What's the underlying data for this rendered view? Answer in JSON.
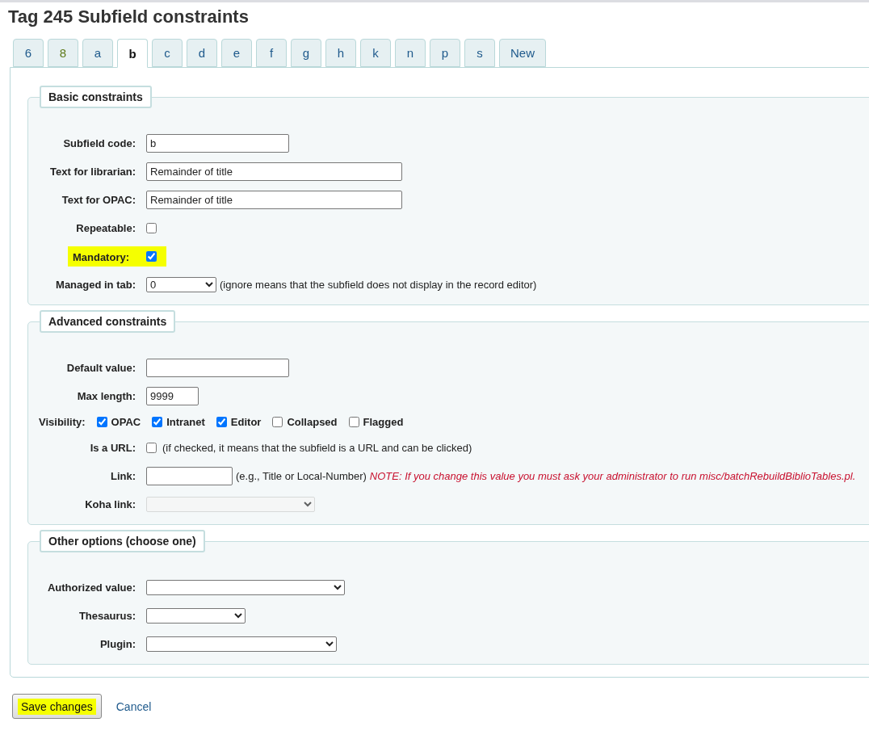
{
  "title": "Tag 245 Subfield constraints",
  "tabs": [
    {
      "label": "6",
      "selected": false,
      "color": "#1f5a8c"
    },
    {
      "label": "8",
      "selected": false,
      "color": "#5e7a1a"
    },
    {
      "label": "a",
      "selected": false,
      "color": "#1f5a8c"
    },
    {
      "label": "b",
      "selected": true,
      "color": "#111111"
    },
    {
      "label": "c",
      "selected": false,
      "color": "#1f5a8c"
    },
    {
      "label": "d",
      "selected": false,
      "color": "#1f5a8c"
    },
    {
      "label": "e",
      "selected": false,
      "color": "#1f5a8c"
    },
    {
      "label": "f",
      "selected": false,
      "color": "#1f5a8c"
    },
    {
      "label": "g",
      "selected": false,
      "color": "#1f5a8c"
    },
    {
      "label": "h",
      "selected": false,
      "color": "#1f5a8c"
    },
    {
      "label": "k",
      "selected": false,
      "color": "#1f5a8c"
    },
    {
      "label": "n",
      "selected": false,
      "color": "#1f5a8c"
    },
    {
      "label": "p",
      "selected": false,
      "color": "#1f5a8c"
    },
    {
      "label": "s",
      "selected": false,
      "color": "#1f5a8c"
    },
    {
      "label": "New",
      "selected": false,
      "color": "#1f5a8c"
    }
  ],
  "sections": [
    {
      "legend": "Basic constraints",
      "fields": [
        {
          "kind": "text",
          "label": "Subfield code:",
          "value": "b",
          "highlighted": false
        },
        {
          "kind": "text",
          "label": "Text for librarian:",
          "value": "Remainder of title",
          "highlighted": false
        },
        {
          "kind": "text",
          "label": "Text for OPAC:",
          "value": "Remainder of title",
          "highlighted": false
        },
        {
          "kind": "checkbox",
          "label": "Repeatable:",
          "checked": false,
          "highlighted": false
        },
        {
          "kind": "checkbox",
          "label": "Mandatory:",
          "checked": true,
          "highlighted": true
        },
        {
          "kind": "select",
          "label": "Managed in tab:",
          "value": "0",
          "hint": "(ignore means that the subfield does not display in the record editor)",
          "disabled": false,
          "highlighted": false
        }
      ]
    },
    {
      "legend": "Advanced constraints",
      "fields": [
        {
          "kind": "text",
          "label": "Default value:",
          "highlighted": false
        },
        {
          "kind": "text",
          "label": "Max length:",
          "value": "9999",
          "highlighted": false
        },
        {
          "kind": "visibility",
          "label": "Visibility:",
          "highlighted": false,
          "options": [
            {
              "label": "OPAC",
              "checked": true
            },
            {
              "label": "Intranet",
              "checked": true
            },
            {
              "label": "Editor",
              "checked": true
            },
            {
              "label": "Collapsed",
              "checked": false
            },
            {
              "label": "Flagged",
              "checked": false
            }
          ]
        },
        {
          "kind": "checkbox",
          "label": "Is a URL:",
          "checked": false,
          "hint": "(if checked, it means that the subfield is a URL and can be clicked)",
          "highlighted": false
        },
        {
          "kind": "text",
          "label": "Link:",
          "hint": "(e.g., Title or Local-Number)",
          "note": "NOTE: If you change this value you must ask your administrator to run misc/batchRebuildBiblioTables.pl.",
          "highlighted": false
        },
        {
          "kind": "select",
          "label": "Koha link:",
          "disabled": true,
          "highlighted": false
        }
      ]
    },
    {
      "legend": "Other options (choose one)",
      "fields": [
        {
          "kind": "select",
          "label": "Authorized value:",
          "disabled": false,
          "highlighted": false
        },
        {
          "kind": "select",
          "label": "Thesaurus:",
          "disabled": false,
          "highlighted": false
        },
        {
          "kind": "select",
          "label": "Plugin:",
          "disabled": false,
          "highlighted": false
        }
      ]
    }
  ],
  "actions": {
    "save": {
      "label": "Save changes",
      "highlighted": true
    },
    "cancel": "Cancel"
  }
}
